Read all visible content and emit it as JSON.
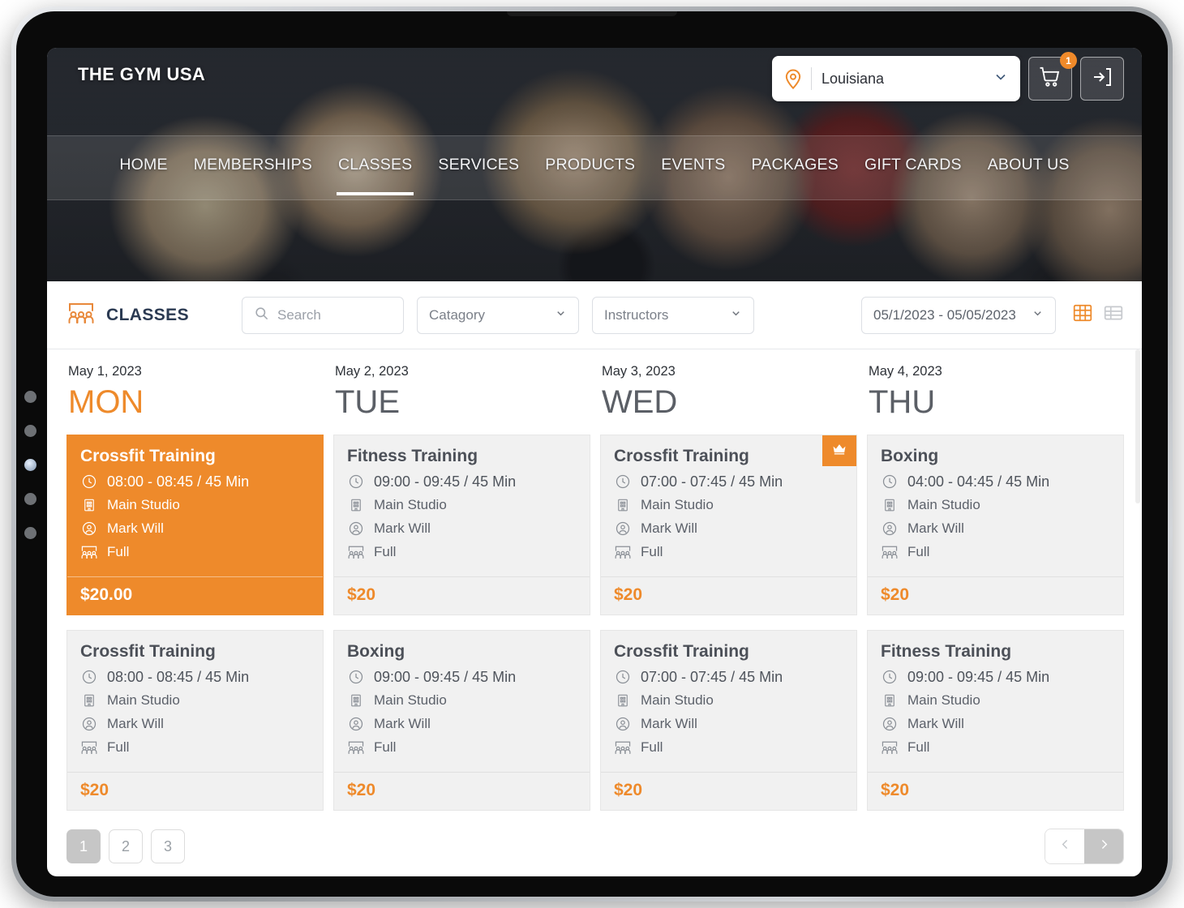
{
  "brand": {
    "name": "THE GYM USA"
  },
  "header": {
    "location": {
      "icon": "location-pin-icon",
      "value": "Louisiana",
      "chevron": "chevron-down-icon"
    },
    "cart": {
      "icon": "shopping-cart-icon",
      "badge": "1"
    },
    "login": {
      "icon": "login-arrow-icon"
    }
  },
  "nav": {
    "items": [
      {
        "label": "HOME",
        "active": false
      },
      {
        "label": "MEMBERSHIPS",
        "active": false
      },
      {
        "label": "CLASSES",
        "active": true
      },
      {
        "label": "SERVICES",
        "active": false
      },
      {
        "label": "PRODUCTS",
        "active": false
      },
      {
        "label": "EVENTS",
        "active": false
      },
      {
        "label": "PACKAGES",
        "active": false
      },
      {
        "label": "GIFT CARDS",
        "active": false
      },
      {
        "label": "ABOUT US",
        "active": false
      }
    ]
  },
  "toolbar": {
    "icon": "classes-people-icon",
    "title": "CLASSES",
    "search": {
      "icon": "search-icon",
      "placeholder": "Search",
      "value": ""
    },
    "category": {
      "label": "Catagory",
      "chevron": "chevron-down-icon"
    },
    "instructors": {
      "label": "Instructors",
      "chevron": "chevron-down-icon"
    },
    "daterange": {
      "label": "05/1/2023 - 05/05/2023",
      "chevron": "chevron-down-icon"
    },
    "views": {
      "grid": {
        "icon": "grid-view-icon",
        "active": true,
        "color": "#ee8a2b"
      },
      "list": {
        "icon": "list-view-icon",
        "active": false,
        "color": "#c7cace"
      }
    }
  },
  "calendar": {
    "columns": [
      {
        "date": "May 1, 2023",
        "day": "MON",
        "highlighted": true,
        "cards": [
          {
            "title": "Crossfit Training",
            "time": "08:00 - 08:45 / 45 Min",
            "room": "Main Studio",
            "instructor": "Mark Will",
            "capacity": "Full",
            "price": "$20.00",
            "featured": true,
            "crown": false
          },
          {
            "title": "Crossfit Training",
            "time": "08:00 - 08:45 / 45 Min",
            "room": "Main Studio",
            "instructor": "Mark Will",
            "capacity": "Full",
            "price": "$20",
            "featured": false,
            "crown": false
          }
        ]
      },
      {
        "date": "May 2, 2023",
        "day": "TUE",
        "highlighted": false,
        "cards": [
          {
            "title": "Fitness Training",
            "time": "09:00 - 09:45 / 45 Min",
            "room": "Main Studio",
            "instructor": "Mark Will",
            "capacity": "Full",
            "price": "$20",
            "featured": false,
            "crown": false
          },
          {
            "title": "Boxing",
            "time": "09:00 - 09:45 / 45 Min",
            "room": "Main Studio",
            "instructor": "Mark Will",
            "capacity": "Full",
            "price": "$20",
            "featured": false,
            "crown": false
          }
        ]
      },
      {
        "date": "May 3, 2023",
        "day": "WED",
        "highlighted": false,
        "cards": [
          {
            "title": "Crossfit Training",
            "time": "07:00 - 07:45 / 45 Min",
            "room": "Main Studio",
            "instructor": "Mark Will",
            "capacity": "Full",
            "price": "$20",
            "featured": false,
            "crown": true
          },
          {
            "title": "Crossfit Training",
            "time": "07:00 - 07:45 / 45 Min",
            "room": "Main Studio",
            "instructor": "Mark Will",
            "capacity": "Full",
            "price": "$20",
            "featured": false,
            "crown": false
          }
        ]
      },
      {
        "date": "May 4, 2023",
        "day": "THU",
        "highlighted": false,
        "cards": [
          {
            "title": "Boxing",
            "time": "04:00 - 04:45 / 45 Min",
            "room": "Main Studio",
            "instructor": "Mark Will",
            "capacity": "Full",
            "price": "$20",
            "featured": false,
            "crown": false
          },
          {
            "title": "Fitness Training",
            "time": "09:00 - 09:45 / 45 Min",
            "room": "Main Studio",
            "instructor": "Mark Will",
            "capacity": "Full",
            "price": "$20",
            "featured": false,
            "crown": false
          }
        ]
      }
    ]
  },
  "pagination": {
    "pages": [
      {
        "label": "1",
        "active": true
      },
      {
        "label": "2",
        "active": false
      },
      {
        "label": "3",
        "active": false
      }
    ],
    "prev": {
      "icon": "chevron-left-icon",
      "enabled": false
    },
    "next": {
      "icon": "chevron-right-icon",
      "enabled": true
    }
  },
  "colors": {
    "accent": "#ee8a2b",
    "title_dark": "#2b3a52",
    "card_bg": "#f1f1f1",
    "text_gray": "#5c616a"
  }
}
